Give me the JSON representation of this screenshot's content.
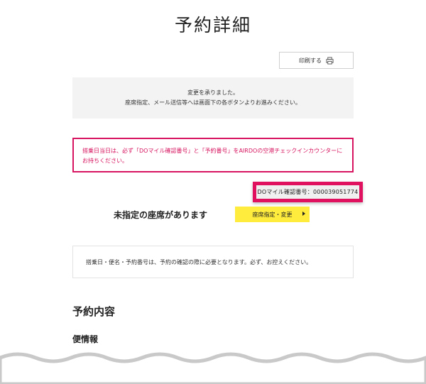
{
  "page": {
    "title": "予約詳細"
  },
  "toolbar": {
    "print_label": "印刷する",
    "print_icon": "printer-icon"
  },
  "notice": {
    "line1": "変更を承りました。",
    "line2": "座席指定、メール送信等へは画面下の各ボタンよりお進みください。"
  },
  "alert": {
    "line1": "搭乗日当日は、必ず「DOマイル確認番号」と「予約番号」をAIRDOの空港チェックインカウンターに",
    "line2": "お持ちください。",
    "color": "#d7145f"
  },
  "mile": {
    "text": "DOマイル確認番号：000039051774",
    "highlight_color": "#e0115f"
  },
  "seat": {
    "label": "未指定の座席があります",
    "button_label": "座席指定・変更",
    "button_color": "#ffec3d"
  },
  "info": {
    "text": "搭乗日・便名・予約番号は、予約の確認の際に必要となります。必ず、お控えください。"
  },
  "sections": {
    "reservation_heading": "予約内容",
    "flight_heading": "便情報"
  }
}
